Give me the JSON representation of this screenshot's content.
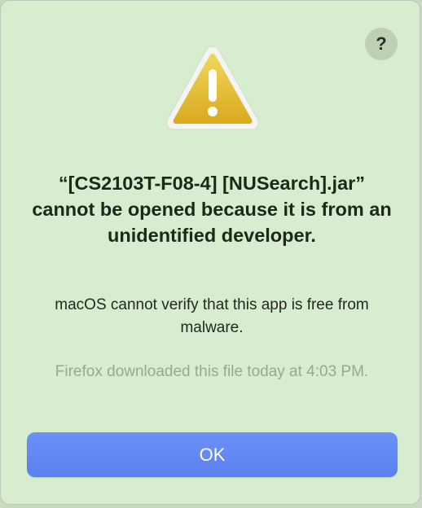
{
  "dialog": {
    "help_label": "?",
    "icon": "warning-triangle-icon",
    "title": "“[CS2103T-F08-4] [NUSearch].jar” cannot be opened because it is from an unidentified developer.",
    "message": "macOS cannot verify that this app is free from malware.",
    "info": "Firefox downloaded this file today at 4:03 PM.",
    "ok_label": "OK"
  },
  "colors": {
    "background": "#d6edcf",
    "accent": "#5f85f3",
    "warning": "#e9c23b"
  }
}
